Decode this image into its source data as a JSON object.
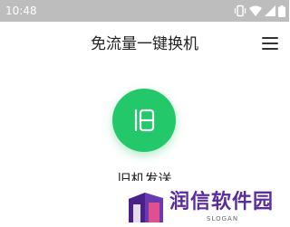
{
  "status_bar": {
    "time": "10:48",
    "icons": [
      "vibrate-icon",
      "wifi-icon",
      "signal-icon",
      "battery-icon"
    ]
  },
  "app_bar": {
    "title": "免流量一键换机",
    "menu_icon": "menu-icon"
  },
  "main": {
    "button_icon": "old-phone-icon",
    "button_label": "旧机发送",
    "accent_color": "#22c86a"
  },
  "watermark": {
    "name": "润信软件园",
    "slogan": "SLOGAN"
  }
}
